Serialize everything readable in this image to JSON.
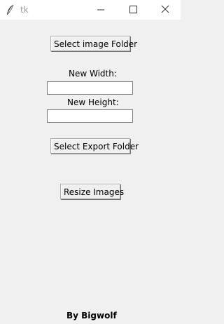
{
  "window": {
    "title": "tk",
    "icon": "feather-icon"
  },
  "buttons": {
    "select_image_folder": "Select image Folder",
    "select_export_folder": "Select Export Folder",
    "resize_images": "Resize Images"
  },
  "fields": {
    "width_label": "New Width:",
    "width_value": "",
    "height_label": "New Height:",
    "height_value": ""
  },
  "footer": {
    "credit": "By Bigwolf"
  }
}
